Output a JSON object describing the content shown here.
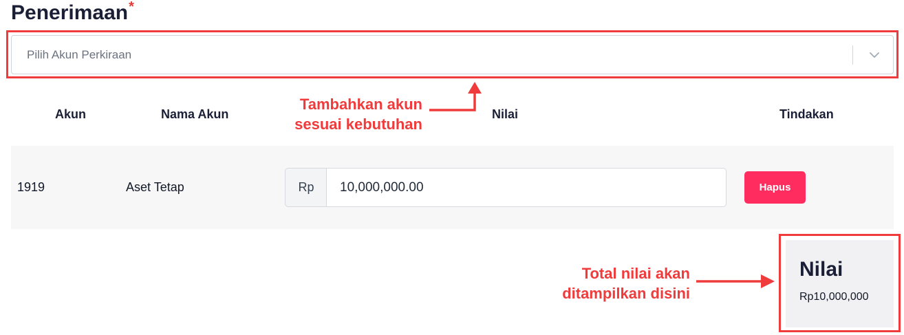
{
  "section": {
    "title": "Penerimaan",
    "required_mark": "*"
  },
  "account_select": {
    "placeholder": "Pilih Akun Perkiraan",
    "chevron_icon": "chevron-down-icon"
  },
  "table": {
    "headers": {
      "account": "Akun",
      "account_name": "Nama Akun",
      "value": "Nilai",
      "action": "Tindakan"
    },
    "rows": [
      {
        "account": "1919",
        "account_name": "Aset Tetap",
        "currency": "Rp",
        "value": "10,000,000.00",
        "action_label": "Hapus"
      }
    ]
  },
  "summary": {
    "label": "Nilai",
    "value": "Rp10,000,000"
  },
  "annotations": {
    "add_account": [
      "Tambahkan akun",
      "sesuai kebutuhan"
    ],
    "total": [
      "Total nilai akan",
      "ditampilkan disini"
    ]
  },
  "colors": {
    "annotation": "#ef3b3b",
    "danger_button": "#ff2d5f",
    "title": "#1a1f36"
  }
}
